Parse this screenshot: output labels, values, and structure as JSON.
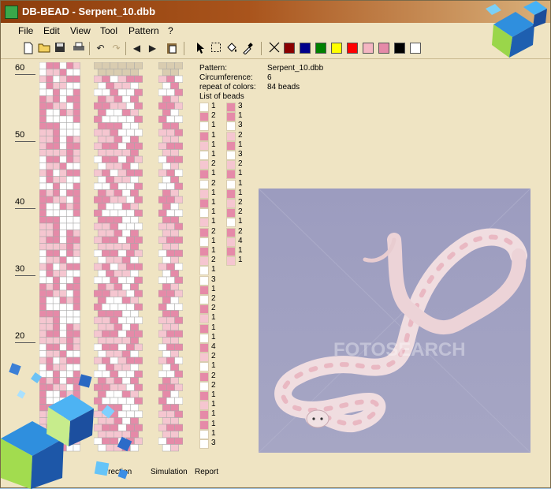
{
  "app": {
    "title": "DB-BEAD - Serpent_10.dbb"
  },
  "menu": [
    "File",
    "Edit",
    "View",
    "Tool",
    "Pattern",
    "?"
  ],
  "toolbar": {
    "icons": [
      "new-file-icon",
      "open-folder-icon",
      "save-icon",
      "print-icon",
      "undo-icon",
      "redo-icon",
      "arrow-left-icon",
      "arrow-right-icon",
      "paste-icon",
      "select-arrow-icon",
      "rect-select-icon",
      "fill-bucket-icon",
      "eyedropper-icon",
      "clear-color-icon"
    ],
    "palette": [
      "#8b0000",
      "#00008b",
      "#008000",
      "#ffff00",
      "#ff0000",
      "#f4b6c2",
      "#e58aa8",
      "#000000",
      "#ffffff"
    ]
  },
  "ruler": {
    "ticks": [
      "60",
      "50",
      "40",
      "30",
      "20"
    ]
  },
  "colors": {
    "pink": "#e58aa8",
    "light_pink": "#f5c6d0",
    "white": "#ffffff",
    "grid": "#a8a8a8"
  },
  "info": {
    "pattern_label": "Pattern:",
    "pattern_value": "Serpent_10.dbb",
    "circ_label": "Circumference:",
    "circ_value": "6",
    "repeat_label": "repeat of colors:",
    "repeat_value": "84 beads",
    "list_label": "List of beads"
  },
  "beads_col1": [
    {
      "c": "white",
      "n": "1"
    },
    {
      "c": "pink",
      "n": "2"
    },
    {
      "c": "white",
      "n": "1"
    },
    {
      "c": "pink",
      "n": "1"
    },
    {
      "c": "light_pink",
      "n": "1"
    },
    {
      "c": "white",
      "n": "1"
    },
    {
      "c": "light_pink",
      "n": "2"
    },
    {
      "c": "pink",
      "n": "1"
    },
    {
      "c": "white",
      "n": "2"
    },
    {
      "c": "light_pink",
      "n": "1"
    },
    {
      "c": "pink",
      "n": "1"
    },
    {
      "c": "white",
      "n": "1"
    },
    {
      "c": "light_pink",
      "n": "1"
    },
    {
      "c": "pink",
      "n": "2"
    },
    {
      "c": "white",
      "n": "1"
    },
    {
      "c": "pink",
      "n": "1"
    },
    {
      "c": "light_pink",
      "n": "2"
    },
    {
      "c": "white",
      "n": "1"
    },
    {
      "c": "white",
      "n": "3"
    },
    {
      "c": "pink",
      "n": "1"
    },
    {
      "c": "white",
      "n": "2"
    },
    {
      "c": "pink",
      "n": "2"
    },
    {
      "c": "light_pink",
      "n": "1"
    },
    {
      "c": "pink",
      "n": "1"
    },
    {
      "c": "white",
      "n": "1"
    },
    {
      "c": "pink",
      "n": "4"
    },
    {
      "c": "light_pink",
      "n": "2"
    },
    {
      "c": "white",
      "n": "1"
    },
    {
      "c": "pink",
      "n": "2"
    },
    {
      "c": "white",
      "n": "2"
    },
    {
      "c": "pink",
      "n": "1"
    },
    {
      "c": "light_pink",
      "n": "1"
    },
    {
      "c": "pink",
      "n": "1"
    },
    {
      "c": "pink",
      "n": "1"
    },
    {
      "c": "white",
      "n": "1"
    },
    {
      "c": "white",
      "n": "3"
    }
  ],
  "beads_col2": [
    {
      "c": "pink",
      "n": "3"
    },
    {
      "c": "pink",
      "n": "1"
    },
    {
      "c": "white",
      "n": "3"
    },
    {
      "c": "light_pink",
      "n": "2"
    },
    {
      "c": "pink",
      "n": "1"
    },
    {
      "c": "white",
      "n": "3"
    },
    {
      "c": "light_pink",
      "n": "2"
    },
    {
      "c": "pink",
      "n": "1"
    },
    {
      "c": "white",
      "n": "1"
    },
    {
      "c": "pink",
      "n": "1"
    },
    {
      "c": "light_pink",
      "n": "2"
    },
    {
      "c": "pink",
      "n": "2"
    },
    {
      "c": "white",
      "n": "1"
    },
    {
      "c": "pink",
      "n": "2"
    },
    {
      "c": "light_pink",
      "n": "4"
    },
    {
      "c": "pink",
      "n": "1"
    },
    {
      "c": "light_pink",
      "n": "1"
    }
  ],
  "bottom": {
    "left": "Correction",
    "simulation": "Simulation",
    "report": "Report"
  },
  "photo": {
    "watermark": "FOTOSEARCH"
  }
}
